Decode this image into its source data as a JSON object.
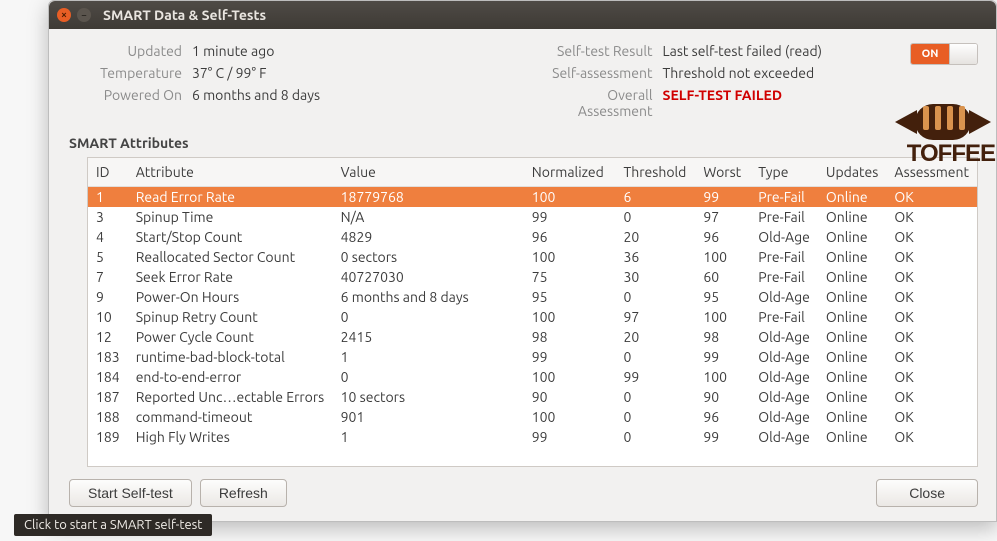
{
  "titlebar": {
    "title": "SMART Data & Self-Tests"
  },
  "summary_left": {
    "updated_k": "Updated",
    "updated_v": "1 minute ago",
    "temp_k": "Temperature",
    "temp_v": "37° C / 99° F",
    "powered_k": "Powered On",
    "powered_v": "6 months and 8 days"
  },
  "summary_right": {
    "result_k": "Self-test Result",
    "result_v": "Last self-test failed (read)",
    "assess_k": "Self-assessment",
    "assess_v": "Threshold not exceeded",
    "overall_k": "Overall Assessment",
    "overall_v": "SELF-TEST FAILED"
  },
  "switch_on": "ON",
  "attributes_title": "SMART Attributes",
  "headers": {
    "id": "ID",
    "attribute": "Attribute",
    "value": "Value",
    "normalized": "Normalized",
    "threshold": "Threshold",
    "worst": "Worst",
    "type": "Type",
    "updates": "Updates",
    "assessment": "Assessment"
  },
  "rows": [
    {
      "id": "1",
      "attr": "Read Error Rate",
      "value": "18779768",
      "norm": "100",
      "thresh": "6",
      "worst": "99",
      "type": "Pre-Fail",
      "updates": "Online",
      "assess": "OK",
      "selected": true
    },
    {
      "id": "3",
      "attr": "Spinup Time",
      "value": "N/A",
      "norm": "99",
      "thresh": "0",
      "worst": "97",
      "type": "Pre-Fail",
      "updates": "Online",
      "assess": "OK"
    },
    {
      "id": "4",
      "attr": "Start/Stop Count",
      "value": "4829",
      "norm": "96",
      "thresh": "20",
      "worst": "96",
      "type": "Old-Age",
      "updates": "Online",
      "assess": "OK"
    },
    {
      "id": "5",
      "attr": "Reallocated Sector Count",
      "value": "0 sectors",
      "norm": "100",
      "thresh": "36",
      "worst": "100",
      "type": "Pre-Fail",
      "updates": "Online",
      "assess": "OK"
    },
    {
      "id": "7",
      "attr": "Seek Error Rate",
      "value": "40727030",
      "norm": "75",
      "thresh": "30",
      "worst": "60",
      "type": "Pre-Fail",
      "updates": "Online",
      "assess": "OK"
    },
    {
      "id": "9",
      "attr": "Power-On Hours",
      "value": "6 months and 8 days",
      "norm": "95",
      "thresh": "0",
      "worst": "95",
      "type": "Old-Age",
      "updates": "Online",
      "assess": "OK"
    },
    {
      "id": "10",
      "attr": "Spinup Retry Count",
      "value": "0",
      "norm": "100",
      "thresh": "97",
      "worst": "100",
      "type": "Pre-Fail",
      "updates": "Online",
      "assess": "OK"
    },
    {
      "id": "12",
      "attr": "Power Cycle Count",
      "value": "2415",
      "norm": "98",
      "thresh": "20",
      "worst": "98",
      "type": "Old-Age",
      "updates": "Online",
      "assess": "OK"
    },
    {
      "id": "183",
      "attr": "runtime-bad-block-total",
      "value": "1",
      "norm": "99",
      "thresh": "0",
      "worst": "99",
      "type": "Old-Age",
      "updates": "Online",
      "assess": "OK"
    },
    {
      "id": "184",
      "attr": "end-to-end-error",
      "value": "0",
      "norm": "100",
      "thresh": "99",
      "worst": "100",
      "type": "Old-Age",
      "updates": "Online",
      "assess": "OK"
    },
    {
      "id": "187",
      "attr": "Reported Unc…ectable Errors",
      "value": "10 sectors",
      "norm": "90",
      "thresh": "0",
      "worst": "90",
      "type": "Old-Age",
      "updates": "Online",
      "assess": "OK"
    },
    {
      "id": "188",
      "attr": "command-timeout",
      "value": "901",
      "norm": "100",
      "thresh": "0",
      "worst": "96",
      "type": "Old-Age",
      "updates": "Online",
      "assess": "OK"
    },
    {
      "id": "189",
      "attr": "High Fly Writes",
      "value": "1",
      "norm": "99",
      "thresh": "0",
      "worst": "99",
      "type": "Old-Age",
      "updates": "Online",
      "assess": "OK"
    }
  ],
  "buttons": {
    "start_selftest": "Start Self-test",
    "refresh": "Refresh",
    "close": "Close"
  },
  "tooltip": "Click to start a SMART self-test",
  "logo_text": "TOFFEE"
}
